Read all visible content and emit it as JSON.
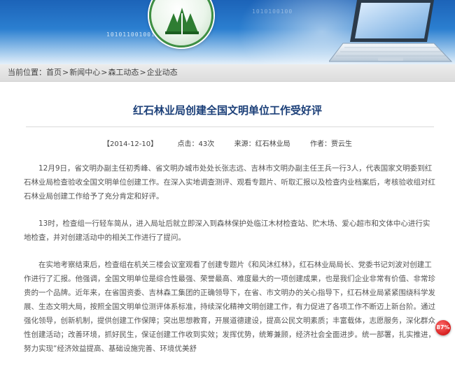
{
  "breadcrumb": {
    "prefix": "当前位置：",
    "items": [
      "首页",
      "新闻中心",
      "森工动态",
      "企业动态"
    ],
    "separator": ">"
  },
  "banner": {
    "binary_text_left": "10101100100101",
    "binary_text_right": "1010100100"
  },
  "article": {
    "title": "红石林业局创建全国文明单位工作受好评",
    "date": "【2014-12-10】",
    "clicks_label": "点击：",
    "clicks_value": "43次",
    "source_label": "来源：",
    "source_value": "红石林业局",
    "author_label": "作者：",
    "author_value": "贾云生",
    "paragraphs": [
      "12月9日，省文明办副主任初秀峰、省文明办城市处处长张志远、吉林市文明办副主任王兵一行3人，代表国家文明委到红石林业局检查验收全国文明单位创建工作。在深入实地调查测评、观看专题片、听取汇报以及检查内业档案后，考核验收组对红石林业局创建工作给予了充分肯定和好评。",
      "13时，检查组一行轻车简从，进入局址后就立即深入到森林保护处临江木材检查站、贮木场、爱心超市和文体中心进行实地检查，并对创建活动中的相关工作进行了提问。",
      "在实地考察结束后，检查组在机关三楼会议室观看了创建专题片《和风沐红林》，红石林业局局长、党委书记刘波对创建工作进行了汇报。他强调，全国文明单位是综合性最强、荣誉最高、难度最大的一项创建成果，也是我们企业非常有价值、非常珍贵的一个品牌。近年来，在省国资委、吉林森工集团的正确领导下，在省、市文明办的关心指导下，红石林业局紧紧围绕科学发展、生态文明大局，按照全国文明单位测评体系标准，持续深化精神文明创建工作，有力促进了各项工作不断迈上新台阶。通过强化领导，创新机制，提供创建工作保障；突出思想教育，开展道德建设，提高公民文明素质；丰富载体，志愿服务，深化群众性创建活动；改善环境，抓好民生，保证创建工作收到实效；发挥优势，统筹兼顾，经济社会全面进步。统一部署，扎实推进，努力实现“经济效益提高、基础设施完善、环境优美舒"
    ]
  },
  "badge": {
    "text": "87%"
  },
  "colors": {
    "title": "#1b3f78",
    "badge": "#d71f1f",
    "banner_top": "#1c63b8"
  }
}
